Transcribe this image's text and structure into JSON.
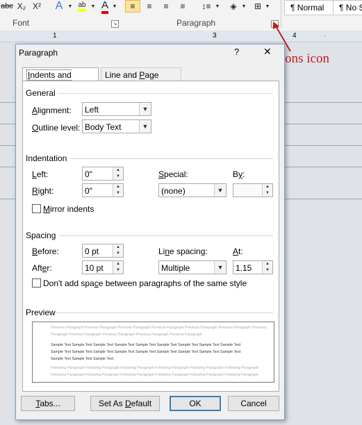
{
  "ribbon": {
    "font_group_label": "Font",
    "paragraph_group_label": "Paragraph",
    "styles": [
      "¶ Normal",
      "¶ No Sp"
    ]
  },
  "annotation": {
    "text": "expanded options icon",
    "color": "#c0201c"
  },
  "dialog": {
    "title": "Paragraph",
    "help": "?",
    "close": "✕",
    "tabs": [
      "Indents and Spacing",
      "Line and Page Breaks"
    ],
    "general": {
      "heading": "General",
      "alignment_label": "Alignment:",
      "alignment_value": "Left",
      "outline_label": "Outline level:",
      "outline_value": "Body Text"
    },
    "indentation": {
      "heading": "Indentation",
      "left_label": "Left:",
      "left_value": "0\"",
      "right_label": "Right:",
      "right_value": "0\"",
      "special_label": "Special:",
      "special_value": "(none)",
      "by_label": "By:",
      "by_value": "",
      "mirror_label": "Mirror indents"
    },
    "spacing": {
      "heading": "Spacing",
      "before_label": "Before:",
      "before_value": "0 pt",
      "after_label": "After:",
      "after_value": "10 pt",
      "line_spacing_label": "Line spacing:",
      "line_spacing_value": "Multiple",
      "at_label": "At:",
      "at_value": "1.15",
      "dont_add_label": "Don't add space between paragraphs of the same style"
    },
    "preview": {
      "heading": "Preview",
      "prev1": "Previous Paragraph Previous Paragraph Previous Paragraph Previous Paragraph Previous Paragraph Previous Paragraph Previous",
      "prev2": "Paragraph Previous Paragraph Previous Paragraph Previous Paragraph Previous Paragraph",
      "sample1": "Sample Text Sample Text Sample Text Sample Text Sample Text Sample Text Sample Text Sample Text Sample Text",
      "sample2": "Sample Text Sample Text Sample Text Sample Text Sample Text Sample Text Sample Text Sample Text Sample Text",
      "sample3": "Sample Text Sample Text Sample Text",
      "follow1": "Following Paragraph Following Paragraph Following Paragraph Following Paragraph Following Paragraph Following Paragraph",
      "follow2": "Following Paragraph Following Paragraph Following Paragraph Following Paragraph Following Paragraph Following Paragraph",
      "follow3": "Following Paragraph Following Paragraph Following Paragraph Following Paragraph Following Paragraph Following Paragraph"
    },
    "buttons": {
      "tabs": "Tabs...",
      "set_default": "Set As Default",
      "ok": "OK",
      "cancel": "Cancel"
    }
  }
}
